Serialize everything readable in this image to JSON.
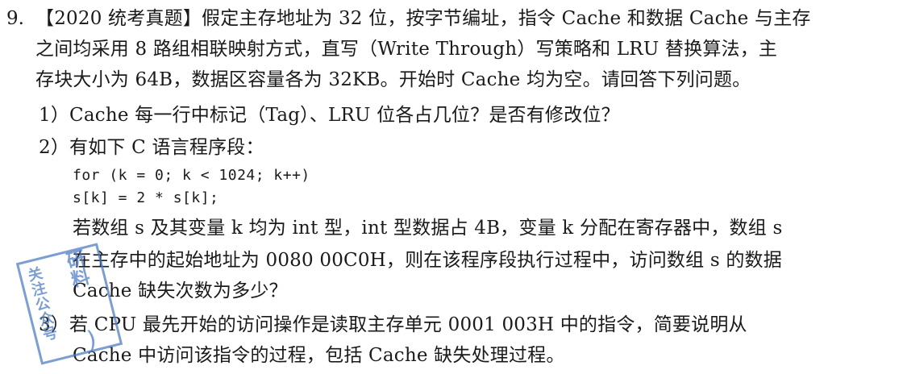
{
  "question": {
    "number": "9.",
    "lines": [
      "【2020 统考真题】假定主存地址为 32 位，按字节编址，指令 Cache 和数据 Cache 与主存",
      "之间均采用 8 路组相联映射方式，直写（Write Through）写策略和 LRU 替换算法，主",
      "存块大小为 64B，数据区容量各为 32KB。开始时 Cache 均为空。请回答下列问题。"
    ],
    "sub_questions": [
      {
        "label": "1）Cache 每一行中标记（Tag）、LRU 位各占几位？是否有修改位？"
      },
      {
        "label": "2）有如下 C 语言程序段：",
        "code": [
          "for (k = 0; k < 1024; k++)",
          "s[k] = 2 * s[k];"
        ],
        "text": [
          "若数组 s 及其变量 k 均为 int 型，int 型数据占 4B，变量 k 分配在寄存器中，数组 s",
          "在主存中的起始地址为 0080 00C0H，则在该程序段执行过程中，访问数组 s 的数据",
          "Cache 缺失次数为多少？"
        ]
      },
      {
        "label": "3）若 CPU 最先开始的访问操作是读取主存单元 0001 003H 中的指令，简要说明从",
        "text": [
          "Cache 中访问该指令的过程，包括 Cache 缺失处理过程。"
        ]
      }
    ]
  },
  "watermark": {
    "left_text": "关注公众号",
    "right_text": "研料"
  },
  "colors": {
    "text": "#1a1a1a",
    "stamp": "#4a79c0"
  }
}
